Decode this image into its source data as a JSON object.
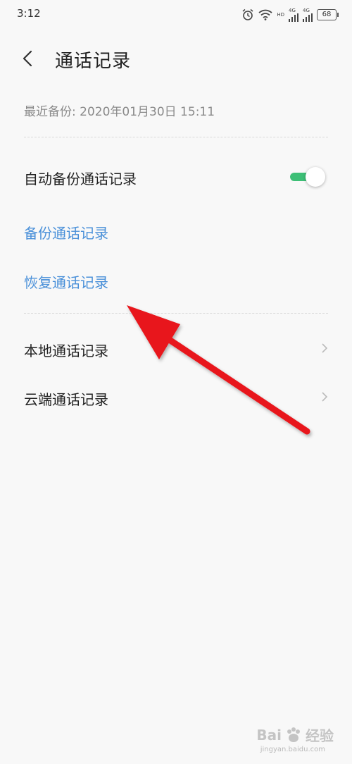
{
  "status_bar": {
    "time": "3:12",
    "icons": [
      "alarm-icon",
      "wifi-icon",
      "signal-icon",
      "signal-icon"
    ],
    "network_tags": [
      "HD",
      "4G",
      "4G"
    ],
    "battery": "68"
  },
  "header": {
    "title": "通话记录"
  },
  "backup": {
    "last_backup": "最近备份: 2020年01月30日  15:11"
  },
  "settings": {
    "auto_backup_label": "自动备份通话记录",
    "auto_backup_on": true,
    "toggle_color": "#3dbf76"
  },
  "actions": {
    "backup_label": "备份通话记录",
    "restore_label": "恢复通话记录",
    "link_color": "#4a90d9"
  },
  "records": [
    {
      "label": "本地通话记录",
      "value": ""
    },
    {
      "label": "云端通话记录",
      "value": ""
    }
  ],
  "annotation": {
    "arrow_color": "#e8141b"
  },
  "watermark": {
    "text": "Bai",
    "suffix": "经验",
    "url": "jingyan.baidu.com"
  }
}
